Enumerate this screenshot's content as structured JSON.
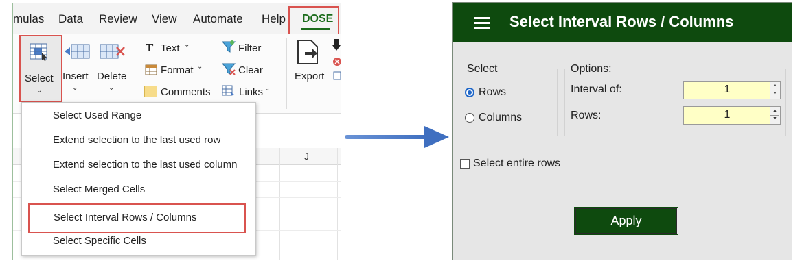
{
  "excel": {
    "tabs": [
      "mulas",
      "Data",
      "Review",
      "View",
      "Automate",
      "Help",
      "DOSE"
    ],
    "ribbon": {
      "select_label": "Select",
      "insert_label": "Insert",
      "delete_label": "Delete",
      "text_label": "Text",
      "format_label": "Format",
      "comments_label": "Comments",
      "filter_label": "Filter",
      "clear_label": "Clear",
      "links_label": "Links",
      "export_label": "Export"
    },
    "column_header": "J",
    "menu_items": [
      "Select Used Range",
      "Extend selection to the last used row",
      "Extend selection to the last used column",
      "Select Merged Cells",
      "Select Interval Rows / Columns",
      "Select Specific Cells"
    ]
  },
  "dialog": {
    "title": "Select Interval Rows / Columns",
    "select_group_label": "Select",
    "radio_rows": "Rows",
    "radio_columns": "Columns",
    "selected_radio": "Rows",
    "options_group_label": "Options:",
    "interval_label": "Interval of:",
    "interval_value": "1",
    "rows_label": "Rows:",
    "rows_value": "1",
    "entire_rows_label": "Select entire rows",
    "entire_rows_checked": false,
    "apply_label": "Apply"
  },
  "colors": {
    "dialog_header": "#0e4a0e",
    "accent_red": "#d9534f",
    "arrow_blue": "#4a7cc7",
    "input_yellow": "#ffffc6"
  }
}
